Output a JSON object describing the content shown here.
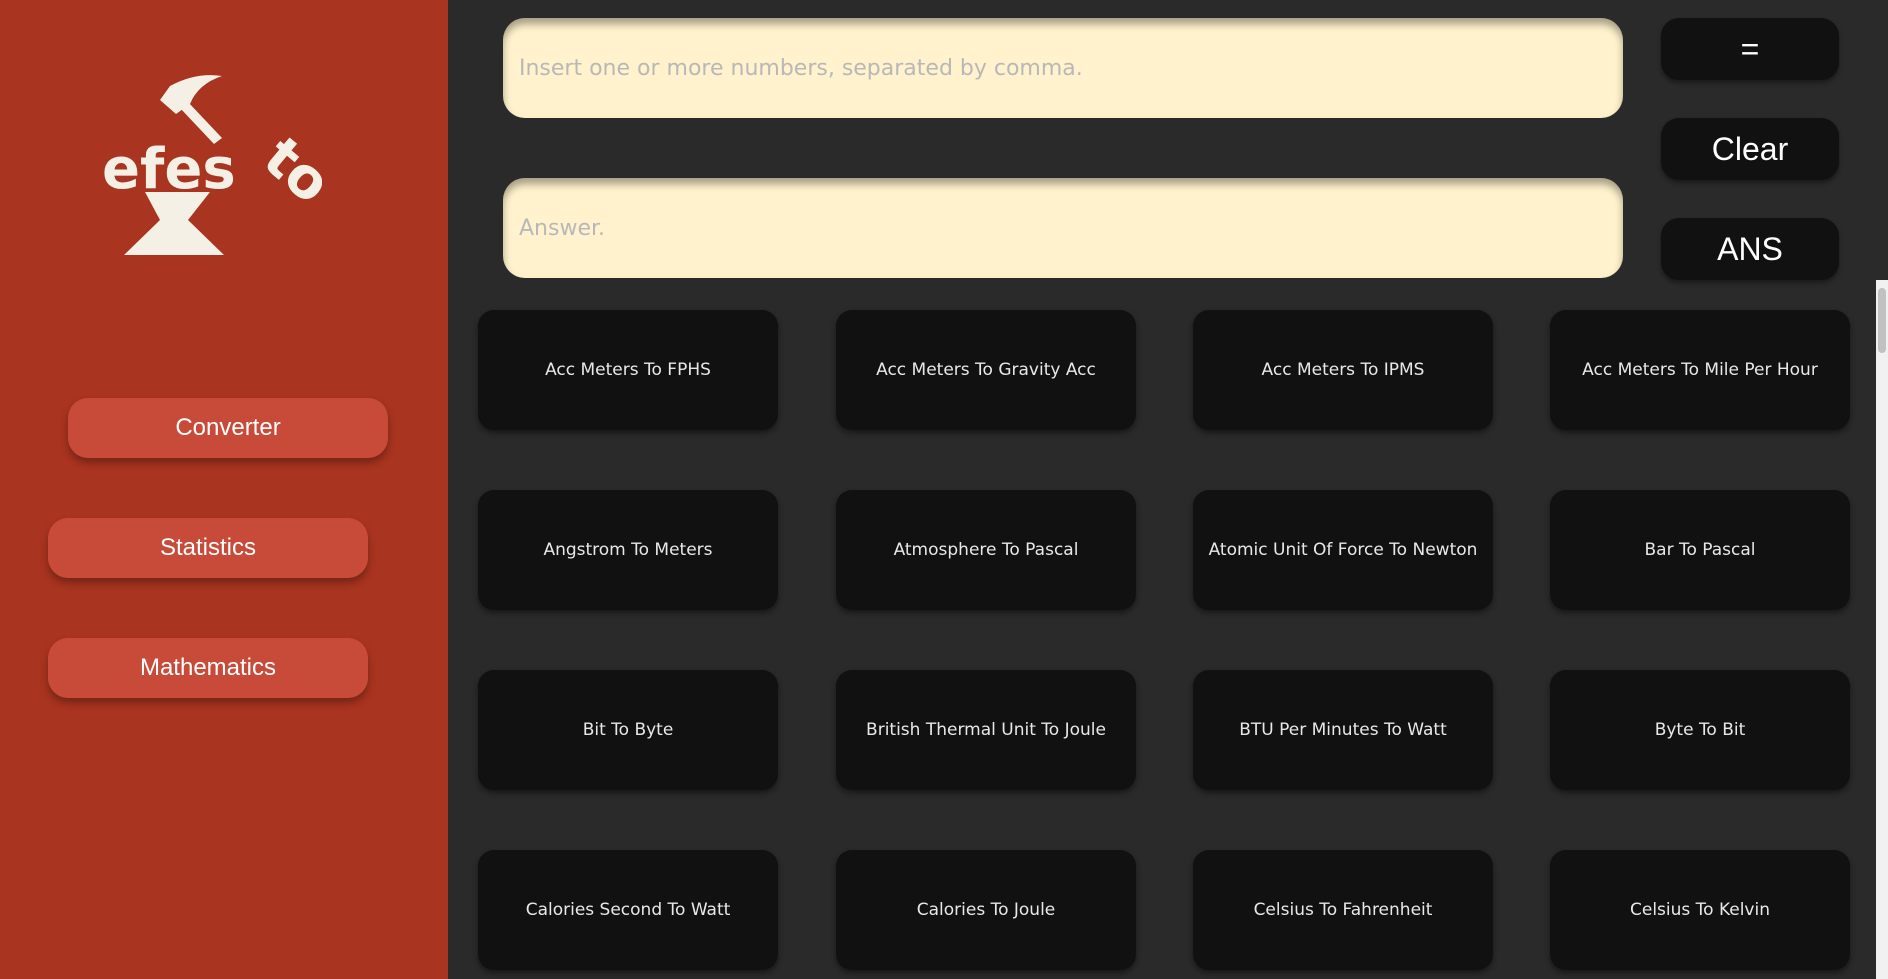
{
  "sidebar": {
    "logo_text": "efesto",
    "nav": [
      {
        "label": "Converter"
      },
      {
        "label": "Statistics"
      },
      {
        "label": "Mathematics"
      }
    ]
  },
  "inputs": {
    "numbers_placeholder": "Insert one or more numbers, separated by comma.",
    "answer_placeholder": "Answer."
  },
  "buttons": {
    "equals": "=",
    "clear": "Clear",
    "ans": "ANS"
  },
  "conversions": [
    "Acc Meters To FPHS",
    "Acc Meters To Gravity Acc",
    "Acc Meters To IPMS",
    "Acc Meters To Mile Per Hour",
    "Angstrom To Meters",
    "Atmosphere To Pascal",
    "Atomic Unit Of Force To Newton",
    "Bar To Pascal",
    "Bit To Byte",
    "British Thermal Unit To Joule",
    "BTU Per Minutes To Watt",
    "Byte To Bit",
    "Calories Second To Watt",
    "Calories To Joule",
    "Celsius To Fahrenheit",
    "Celsius To Kelvin"
  ],
  "colors": {
    "sidebar": "#a93420",
    "nav_button": "#c84b3a",
    "main_bg": "#2a2a2a",
    "field_bg": "#fff2cc",
    "card_bg": "#111111"
  }
}
